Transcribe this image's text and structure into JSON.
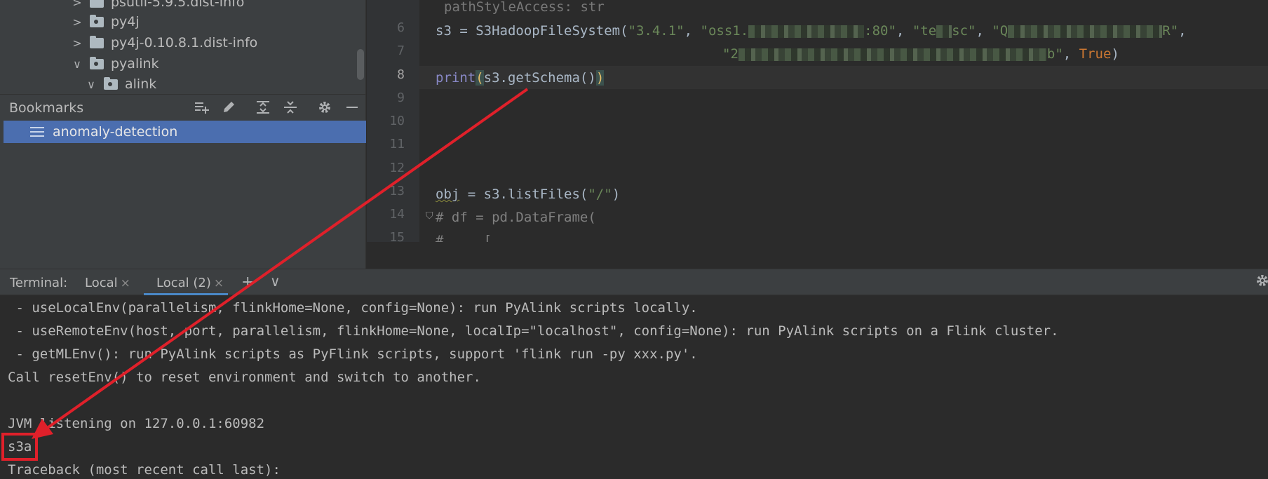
{
  "project_tree": {
    "items": [
      {
        "label": "psutil-5.9.5.dist-info",
        "chevron": ">",
        "icon": "folder-icon"
      },
      {
        "label": "py4j",
        "chevron": ">",
        "icon": "package-folder-icon"
      },
      {
        "label": "py4j-0.10.8.1.dist-info",
        "chevron": ">",
        "icon": "folder-icon"
      },
      {
        "label": "pyalink",
        "chevron": "∨",
        "icon": "package-folder-icon"
      },
      {
        "label": "alink",
        "chevron": "∨",
        "icon": "package-folder-icon"
      }
    ]
  },
  "bookmarks": {
    "title": "Bookmarks",
    "tools": [
      "add-bookmark-icon",
      "edit-icon",
      "expand-all-icon",
      "collapse-all-icon",
      "gear-icon",
      "minimize-icon"
    ],
    "items": [
      {
        "label": "anomaly-detection",
        "icon": "bookmark-list-icon"
      }
    ]
  },
  "editor": {
    "hint_line": "pathStyleAccess: str",
    "line_numbers": [
      "6",
      "7",
      "8",
      "9",
      "10",
      "11",
      "12",
      "13",
      "14",
      "15"
    ],
    "line6": {
      "a": "s3 = S3HadoopFileSystem(",
      "s1": "\"3.4.1\"",
      "c1": ", ",
      "s2a": "\"oss1.",
      "s2b": ":80\"",
      "c2": ", ",
      "s3a": "\"te",
      "s3b": "sc\"",
      "c3": ", ",
      "s4a": "\"Q",
      "s4b": "R\"",
      "c4": ","
    },
    "line7": {
      "s1a": "\"2",
      "s1b": "b\"",
      "c1": ", ",
      "kw": "True",
      "end": ")"
    },
    "line8": {
      "fn": "print",
      "open": "(",
      "body": "s3.getSchema()",
      "close": ")"
    },
    "line13": {
      "a": "obj",
      "b": " = s3.listFiles(",
      "s": "\"/\"",
      "c": ")"
    },
    "line14": "# df = pd.DataFrame(",
    "line15": "#     ["
  },
  "terminal": {
    "title": "Terminal:",
    "tabs": [
      {
        "label": "Local",
        "close": "×"
      },
      {
        "label": "Local (2)",
        "close": "×"
      }
    ],
    "add": "+",
    "more": "∨",
    "lines": [
      " - useLocalEnv(parallelism, flinkHome=None, config=None): run PyAlink scripts locally.",
      " - useRemoteEnv(host, port, parallelism, flinkHome=None, localIp=\"localhost\", config=None): run PyAlink scripts on a Flink cluster.",
      " - getMLEnv(): run PyAlink scripts as PyFlink scripts, support 'flink run -py xxx.py'.",
      "Call resetEnv() to reset environment and switch to another.",
      "",
      "JVM listening on 127.0.0.1:60982",
      "s3a",
      "Traceback (most recent call last):"
    ]
  },
  "annotation": {
    "color": "#e0202a"
  }
}
